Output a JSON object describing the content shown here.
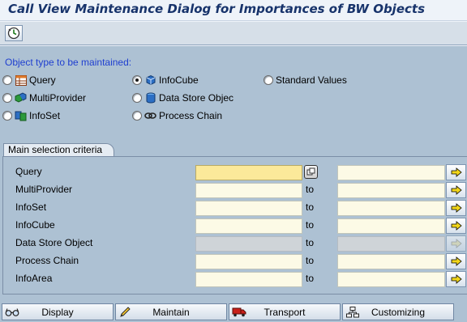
{
  "window": {
    "title": "Call View Maintenance Dialog for Importances of BW Objects"
  },
  "toolbar": {
    "execute_icon": "execute-clock-icon"
  },
  "object_type": {
    "label": "Object type to be maintained:",
    "options": [
      {
        "label": "Query",
        "icon": "query-table-icon",
        "selected": false
      },
      {
        "label": "InfoCube",
        "icon": "infocube-icon",
        "selected": true
      },
      {
        "label": "Standard Values",
        "icon": "",
        "selected": false
      },
      {
        "label": "MultiProvider",
        "icon": "multiprovider-icon",
        "selected": false
      },
      {
        "label": "Data Store Objec",
        "icon": "datastore-icon",
        "selected": false
      },
      {
        "label": "InfoSet",
        "icon": "infoset-icon",
        "selected": false
      },
      {
        "label": "Process Chain",
        "icon": "process-chain-icon",
        "selected": false
      }
    ]
  },
  "selection": {
    "tab_label": "Main selection criteria",
    "to_label": "to",
    "rows": [
      {
        "label": "Query",
        "from": "",
        "to": "",
        "enabled": true
      },
      {
        "label": "MultiProvider",
        "from": "",
        "to": "",
        "enabled": true
      },
      {
        "label": "InfoSet",
        "from": "",
        "to": "",
        "enabled": true
      },
      {
        "label": "InfoCube",
        "from": "",
        "to": "",
        "enabled": true
      },
      {
        "label": "Data Store Object",
        "from": "",
        "to": "",
        "enabled": false
      },
      {
        "label": "Process Chain",
        "from": "",
        "to": "",
        "enabled": true
      },
      {
        "label": "InfoArea",
        "from": "",
        "to": "",
        "enabled": true
      }
    ]
  },
  "buttons": {
    "display": "Display",
    "maintain": "Maintain",
    "transport": "Transport",
    "customizing": "Customizing"
  },
  "colors": {
    "title": "#17336b",
    "label_blue": "#1f3fd0",
    "panel": "#adc1d3",
    "input": "#fcfae6",
    "input_focus": "#fbe99a",
    "arrow_yellow": "#f2d61a"
  }
}
